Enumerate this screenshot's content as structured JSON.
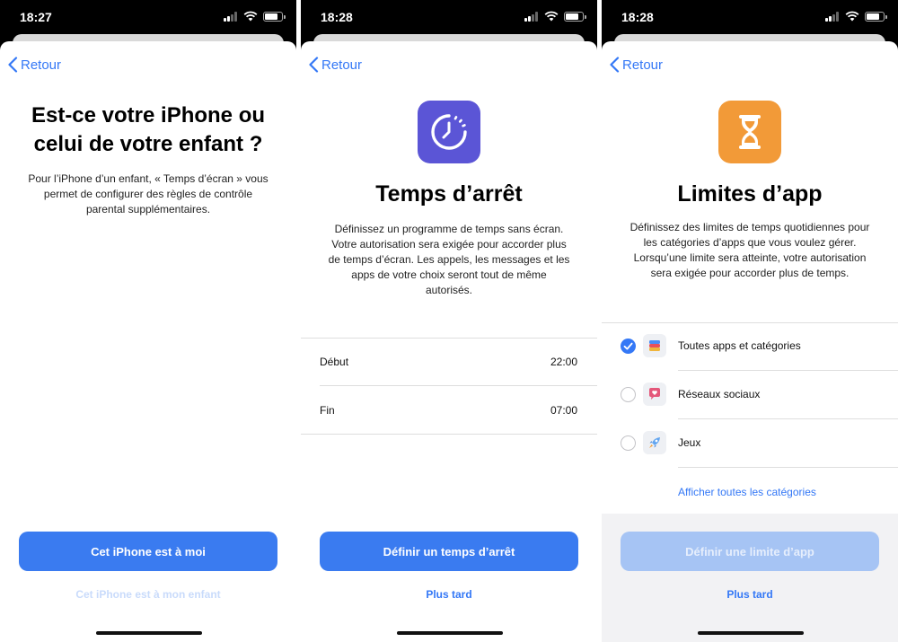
{
  "colors": {
    "accent": "#3478f6",
    "downtime_icon": "#5b55d6",
    "app_limits_icon": "#f29a38"
  },
  "screens": [
    {
      "time": "18:27",
      "back_label": "Retour",
      "title_line1": "Est-ce votre iPhone ou",
      "title_line2": "celui de votre enfant ?",
      "desc_line1": "Pour l’iPhone d’un enfant, « Temps d’écran » vous",
      "desc_line2": "permet de configurer des règles de contrôle",
      "desc_line3": "parental supplémentaires.",
      "primary_button": "Cet iPhone est à moi",
      "secondary_link": "Cet iPhone est à mon enfant"
    },
    {
      "time": "18:28",
      "back_label": "Retour",
      "icon": "downtime-clock-icon",
      "title": "Temps d’arrêt",
      "desc_line1": "Définissez un programme de temps sans écran.",
      "desc_line2": "Votre autorisation sera exigée pour accorder plus",
      "desc_line3": "de temps d’écran. Les appels, les messages et les",
      "desc_line4": "apps de votre choix seront tout de même",
      "desc_line5": "autorisés.",
      "rows": [
        {
          "label": "Début",
          "value": "22:00"
        },
        {
          "label": "Fin",
          "value": "07:00"
        }
      ],
      "primary_button": "Définir un temps d’arrêt",
      "secondary_link": "Plus tard"
    },
    {
      "time": "18:28",
      "back_label": "Retour",
      "icon": "hourglass-icon",
      "title": "Limites d’app",
      "desc_line1": "Définissez des limites de temps quotidiennes pour",
      "desc_line2": "les catégories d’apps que vous voulez gérer.",
      "desc_line3": "Lorsqu’une limite sera atteinte, votre autorisation",
      "desc_line4": "sera exigée pour accorder plus de temps.",
      "categories": [
        {
          "label": "Toutes apps et catégories",
          "checked": true,
          "icon": "stack-icon"
        },
        {
          "label": "Réseaux sociaux",
          "checked": false,
          "icon": "chat-bubble-heart-icon"
        },
        {
          "label": "Jeux",
          "checked": false,
          "icon": "rocket-icon"
        }
      ],
      "show_all_link": "Afficher toutes les catégories",
      "primary_button": "Définir une limite d’app",
      "secondary_link": "Plus tard"
    }
  ]
}
